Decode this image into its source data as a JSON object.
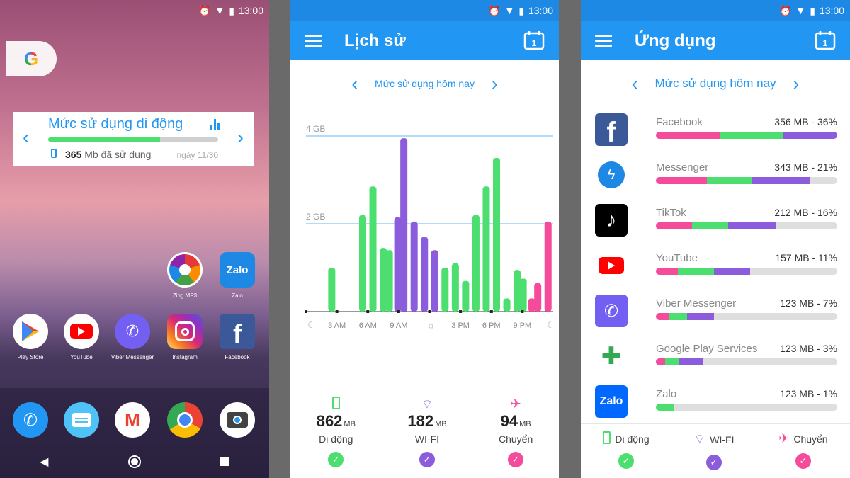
{
  "status": {
    "time": "13:00"
  },
  "home": {
    "google_label": "G",
    "widget": {
      "title": "Mức sử dụng di động",
      "used_value": "365",
      "used_text": "Mb đã sử dụng",
      "day_text": "ngày 11/30",
      "progress": 0.66
    },
    "apps_row1": [
      {
        "label": "Zing MP3",
        "icon": "zing-mp3-icon"
      },
      {
        "label": "Zalo",
        "icon": "zalo-icon"
      }
    ],
    "apps_row2": [
      {
        "label": "Play Store",
        "icon": "play-store-icon"
      },
      {
        "label": "YouTube",
        "icon": "youtube-icon"
      },
      {
        "label": "Viber Messenger",
        "icon": "viber-icon"
      },
      {
        "label": "Instagram",
        "icon": "instagram-icon"
      },
      {
        "label": "Facebook",
        "icon": "facebook-icon"
      }
    ],
    "dock": [
      "phone-icon",
      "messages-icon",
      "gmail-icon",
      "chrome-icon",
      "camera-icon"
    ]
  },
  "history": {
    "title": "Lịch sử",
    "nav_label": "Mức sử dụng hôm nay",
    "colors": {
      "mobile": "#f44b9a",
      "wifi": "#4cde6e",
      "flight": "#8b5cdb"
    },
    "stats": [
      {
        "value": "862",
        "unit": "MB",
        "label": "Di động",
        "color": "#4cde6e",
        "icon": "phone-icon"
      },
      {
        "value": "182",
        "unit": "MB",
        "label": "WI-FI",
        "color": "#8b5cdb",
        "icon": "wifi-icon"
      },
      {
        "value": "94",
        "unit": "MB",
        "label": "Chuyển",
        "color": "#f44b9a",
        "icon": "airplane-icon"
      }
    ]
  },
  "chart_data": {
    "type": "bar",
    "ylabel_ticks": [
      "2 GB",
      "4 GB"
    ],
    "ylim": [
      0,
      4
    ],
    "x_ticks": [
      "3 AM",
      "6 AM",
      "9 AM",
      "3 PM",
      "6 PM",
      "9 PM"
    ],
    "hours": [
      0,
      1,
      2,
      3,
      4,
      5,
      6,
      7,
      8,
      9,
      10,
      11,
      12,
      13,
      14,
      15,
      16,
      17,
      18,
      19,
      20,
      21,
      22,
      23
    ],
    "series": [
      {
        "values": [
          0,
          0,
          1.0,
          0,
          0,
          2.2,
          2.85,
          1.45,
          1.4,
          0,
          0,
          0,
          0,
          1.0,
          1.1,
          0.7,
          2.2,
          2.85,
          3.5,
          0.3,
          0.95,
          0.75,
          0,
          0
        ]
      },
      {
        "values": [
          0,
          0,
          0,
          0,
          0,
          0,
          0,
          0,
          2.15,
          3.95,
          2.05,
          1.7,
          1.4,
          0,
          0,
          0,
          0,
          0,
          0,
          0,
          0,
          0,
          0,
          0
        ]
      },
      {
        "values": [
          0,
          0,
          0,
          0,
          0,
          0,
          0,
          0,
          0,
          0,
          0,
          0,
          0,
          0,
          0,
          0,
          0,
          0,
          0,
          0,
          0,
          0.3,
          0.65,
          2.05
        ]
      }
    ]
  },
  "apps": {
    "title": "Ứng dụng",
    "nav_label": "Mức sử dụng hôm nay",
    "list": [
      {
        "name": "Facebook",
        "usage": "356 MB - 36%",
        "icon": "facebook-icon",
        "m": 0.35,
        "w": 0.35,
        "f": 0.3,
        "bg": "#3b5998"
      },
      {
        "name": "Messenger",
        "usage": "343 MB - 21%",
        "icon": "messenger-icon",
        "m": 0.28,
        "w": 0.25,
        "f": 0.32,
        "bg": "#ffffff"
      },
      {
        "name": "TikTok",
        "usage": "212 MB - 16%",
        "icon": "tiktok-icon",
        "m": 0.2,
        "w": 0.2,
        "f": 0.26,
        "bg": "#000000"
      },
      {
        "name": "YouTube",
        "usage": "157 MB - 11%",
        "icon": "youtube-icon",
        "m": 0.12,
        "w": 0.2,
        "f": 0.2,
        "bg": "#ffffff"
      },
      {
        "name": "Viber Messenger",
        "usage": "123 MB - 7%",
        "icon": "viber-icon",
        "m": 0.07,
        "w": 0.1,
        "f": 0.15,
        "bg": "#7360f2"
      },
      {
        "name": "Google Play Services",
        "usage": "123 MB - 3%",
        "icon": "google-play-services-icon",
        "m": 0.05,
        "w": 0.08,
        "f": 0.13,
        "bg": "#ffffff"
      },
      {
        "name": "Zalo",
        "usage": "123 MB - 1%",
        "icon": "zalo-icon",
        "m": 0.0,
        "w": 0.1,
        "f": 0.0,
        "bg": "#0068ff"
      }
    ],
    "legend": [
      {
        "label": "Di động",
        "color": "#4cde6e",
        "icon": "phone-icon"
      },
      {
        "label": "WI-FI",
        "color": "#8b5cdb",
        "icon": "wifi-icon"
      },
      {
        "label": "Chuyển",
        "color": "#f44b9a",
        "icon": "airplane-icon"
      }
    ]
  }
}
